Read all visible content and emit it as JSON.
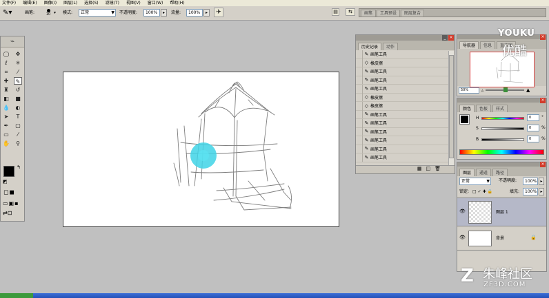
{
  "menubar": {
    "items": [
      "文件(F)",
      "编辑(E)",
      "图像(I)",
      "图层(L)",
      "选择(S)",
      "滤镜(T)",
      "视图(V)",
      "窗口(W)",
      "帮助(H)"
    ]
  },
  "options": {
    "brush_label": "画笔:",
    "brush_size": "10",
    "mode_label": "模式:",
    "mode_value": "正常",
    "opacity_label": "不透明度:",
    "opacity_value": "100%",
    "flow_label": "流量:",
    "flow_value": "100%",
    "well_tabs": [
      "画笔",
      "工具预设",
      "图层复合"
    ]
  },
  "history": {
    "tabs": [
      "历史记录",
      "动作"
    ],
    "items": [
      {
        "icon": "brush",
        "label": "画笔工具"
      },
      {
        "icon": "eraser",
        "label": "橡皮擦"
      },
      {
        "icon": "brush",
        "label": "画笔工具"
      },
      {
        "icon": "brush",
        "label": "画笔工具"
      },
      {
        "icon": "brush",
        "label": "画笔工具"
      },
      {
        "icon": "eraser",
        "label": "橡皮擦"
      },
      {
        "icon": "eraser",
        "label": "橡皮擦"
      },
      {
        "icon": "brush",
        "label": "画笔工具"
      },
      {
        "icon": "brush",
        "label": "画笔工具"
      },
      {
        "icon": "brush",
        "label": "画笔工具"
      },
      {
        "icon": "brush",
        "label": "画笔工具"
      },
      {
        "icon": "brush",
        "label": "画笔工具"
      },
      {
        "icon": "brush",
        "label": "画笔工具"
      }
    ]
  },
  "navigator": {
    "tabs": [
      "导航器",
      "信息",
      "直方图"
    ],
    "zoom": "50%"
  },
  "color": {
    "tabs": [
      "颜色",
      "色板",
      "样式"
    ],
    "h_label": "H",
    "s_label": "S",
    "b_label": "B",
    "h_value": "0",
    "s_value": "0",
    "b_value": "0",
    "h_unit": "°",
    "s_unit": "%",
    "b_unit": "%"
  },
  "layers": {
    "tabs": [
      "图层",
      "通道",
      "路径"
    ],
    "blend_mode": "正常",
    "opacity_label": "不透明度:",
    "opacity_value": "100%",
    "lock_label": "锁定:",
    "fill_label": "填充:",
    "fill_value": "100%",
    "items": [
      {
        "name": "图层 1",
        "selected": true
      },
      {
        "name": "背景",
        "selected": false
      }
    ]
  },
  "watermark": {
    "youku": "YOUKU",
    "youku_cn": "优酷",
    "brand_cn": "朱峰社区",
    "brand_url": "ZF3D.COM"
  },
  "colors": {
    "accent_cyan": "#4dd8e8",
    "selected_layer": "#b5b8c8",
    "panel_bg": "#d4d0c8"
  }
}
